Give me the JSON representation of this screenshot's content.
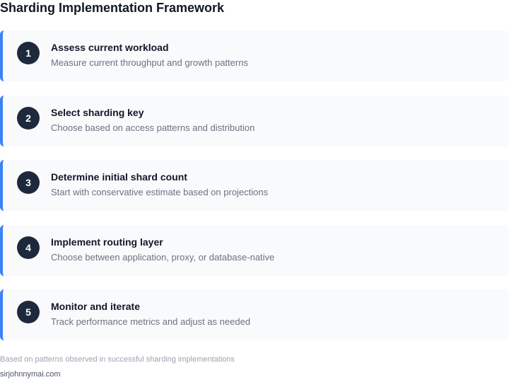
{
  "title": "Sharding Implementation Framework",
  "accent_color": "#3b82f6",
  "badge_color": "#1e293b",
  "steps": [
    {
      "number": "1",
      "title": "Assess current workload",
      "description": "Measure current throughput and growth patterns"
    },
    {
      "number": "2",
      "title": "Select sharding key",
      "description": "Choose based on access patterns and distribution"
    },
    {
      "number": "3",
      "title": "Determine initial shard count",
      "description": "Start with conservative estimate based on projections"
    },
    {
      "number": "4",
      "title": "Implement routing layer",
      "description": "Choose between application, proxy, or database-native"
    },
    {
      "number": "5",
      "title": "Monitor and iterate",
      "description": "Track performance metrics and adjust as needed"
    }
  ],
  "footer": {
    "note": "Based on patterns observed in successful sharding implementations",
    "credit": "sirjohnnymai.com"
  }
}
